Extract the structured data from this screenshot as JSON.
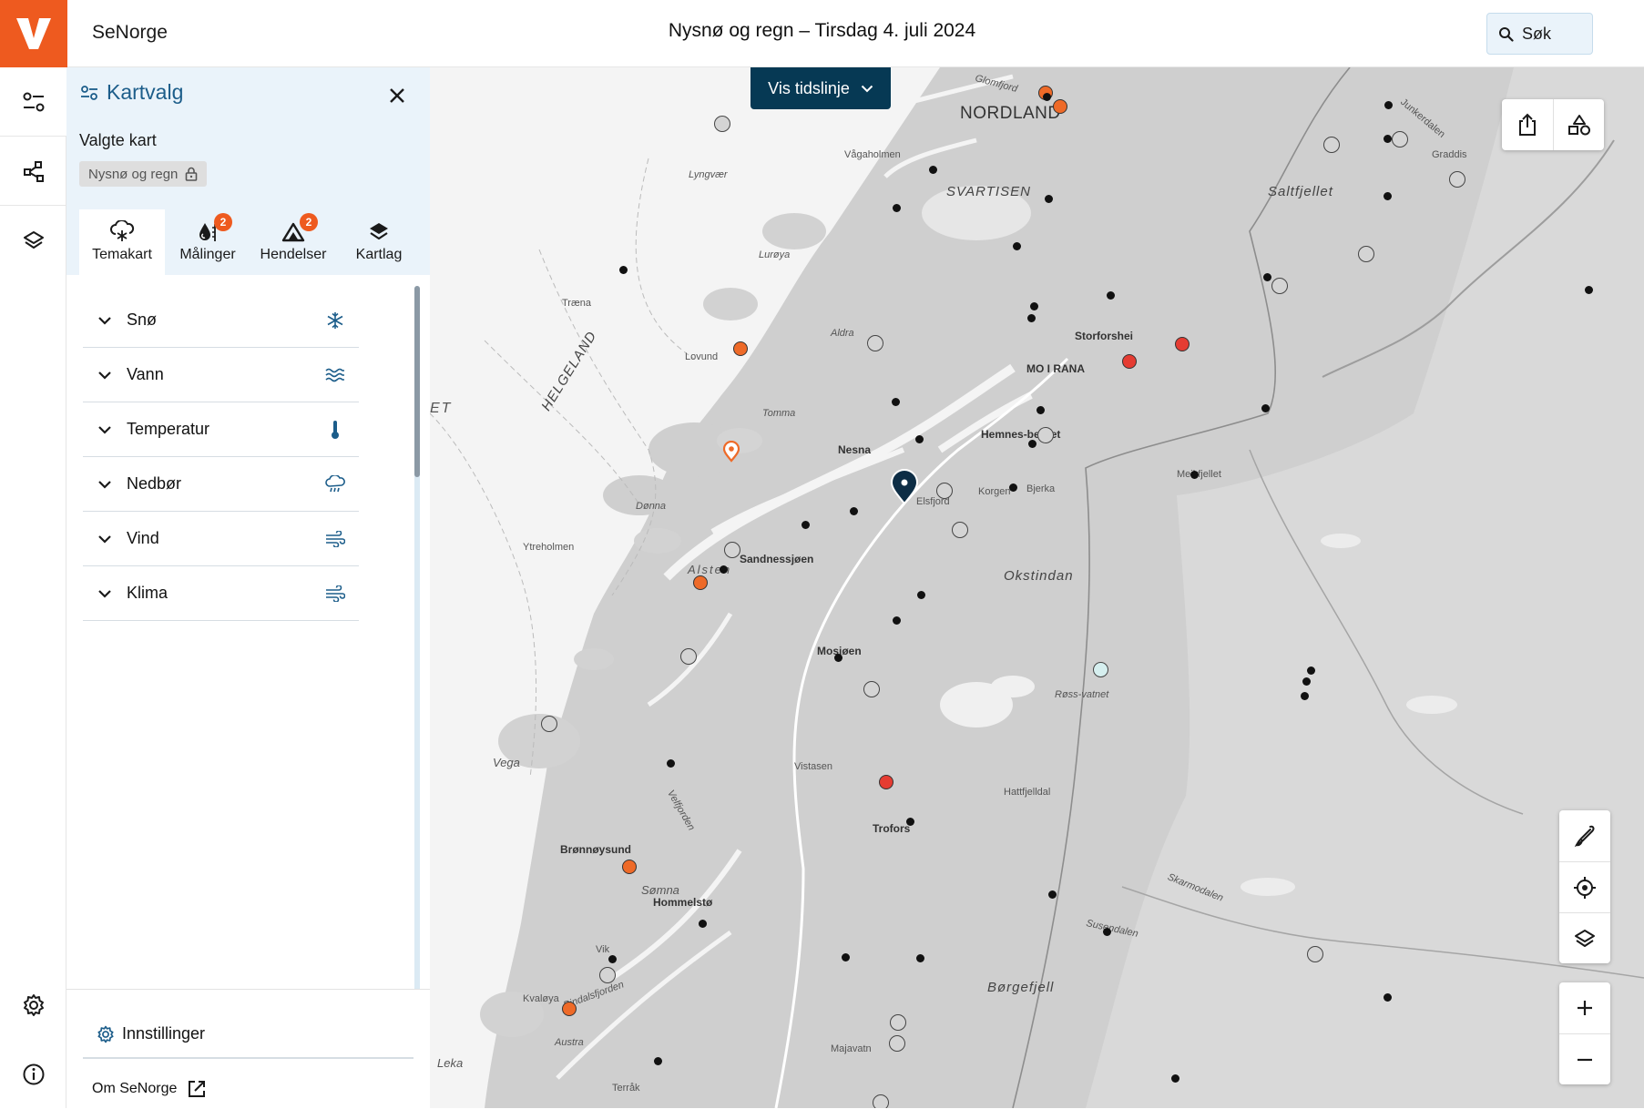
{
  "header": {
    "app_name": "SeNorge",
    "title": "Nysnø og regn – Tirsdag 4. juli 2024",
    "search_placeholder": "Søk",
    "logo_letter": "V",
    "brand_color": "#ee5a1f"
  },
  "rail": {
    "items": [
      "sliders-icon",
      "share-nodes-icon",
      "layers-icon"
    ],
    "bottom": [
      "gear-icon",
      "info-icon"
    ]
  },
  "panel": {
    "title": "Kartvalg",
    "selected_label": "Valgte kart",
    "selected_chip": "Nysnø og regn",
    "tabs": [
      {
        "label": "Temakart",
        "icon": "cloud-snow-icon",
        "badge": null,
        "active": true
      },
      {
        "label": "Målinger",
        "icon": "droplet-gauge-icon",
        "badge": "2",
        "active": false
      },
      {
        "label": "Hendelser",
        "icon": "warning-triangle-icon",
        "badge": "2",
        "active": false
      },
      {
        "label": "Kartlag",
        "icon": "stack-icon",
        "badge": null,
        "active": false
      }
    ],
    "categories": [
      {
        "label": "Snø",
        "icon": "snowflake-icon"
      },
      {
        "label": "Vann",
        "icon": "waves-icon"
      },
      {
        "label": "Temperatur",
        "icon": "thermometer-icon"
      },
      {
        "label": "Nedbør",
        "icon": "rain-cloud-icon"
      },
      {
        "label": "Vind",
        "icon": "wind-icon"
      },
      {
        "label": "Klima",
        "icon": "wind-icon"
      }
    ],
    "settings_label": "Innstillinger",
    "about_label": "Om SeNorge"
  },
  "map": {
    "timeline_button": "Vis tidslinje",
    "labels": {
      "nordland": "NORDLAND",
      "svartisen": "SVARTISEN",
      "saltfjellet": "Saltfjellet",
      "okstindan": "Okstindan",
      "borgefjell": "Børgefjell",
      "helgeland": "HELGELAND",
      "mo_i_rana": "MO I RANA",
      "sandnessjoen": "Sandnessjøen",
      "mosjoen": "Mosjøen",
      "bronnoysund": "Brønnøysund",
      "hemnesberget": "Hemnes-berget",
      "nesna": "Nesna",
      "vega": "Vega",
      "lurøy": "Lurøya",
      "traena": "Træna",
      "dønna": "Dønna",
      "leka": "Leka",
      "trofors": "Trofors",
      "korgen": "Korgen",
      "elsfjord": "Elsfjord",
      "storforshei": "Storforshei",
      "somna": "Sømna",
      "vik": "Vik",
      "hommelsto": "Hommelstø",
      "et": "ET",
      "gildeskal": "Graddis",
      "alsten": "Alsten",
      "tomma": "Tomma",
      "aldra": "Aldra",
      "lovund": "Lovund",
      "lyngvaer": "Lyngvær",
      "vagaholmen": "Vågaholmen",
      "glomfjord": "Glomfjord",
      "junkerdalen": "Junkerdalen",
      "susendalen": "Susendalen",
      "skarmodalen": "Skarmodalen",
      "austra": "Austra",
      "vistasen": "Vistasen",
      "velfjorden": "Velfjorden",
      "rossvatnet": "Røss-vatnet",
      "kvaloya": "Kvaløya",
      "bjerka": "Bjerka",
      "mjolan": "Meikfjellet",
      "ytreholmen": "Ytreholmen",
      "hattfjelldal": "Hattfjelldal",
      "majavatn": "Majavatn",
      "terråk": "Terråk",
      "bindalsfjorden": "Bindalsfjorden"
    },
    "tools_top": [
      "share-icon",
      "shapes-icon"
    ],
    "tools_side": [
      "draw-icon",
      "locate-icon",
      "layers-icon"
    ],
    "zoom": [
      "+",
      "−"
    ],
    "colors": {
      "marker_orange": "#ee6a28",
      "marker_red": "#e53c32",
      "marker_light": "#d6efef",
      "marker_gray": "#d4d4d4",
      "marker_black": "#111111",
      "pin_dark": "#0d2d45"
    }
  }
}
